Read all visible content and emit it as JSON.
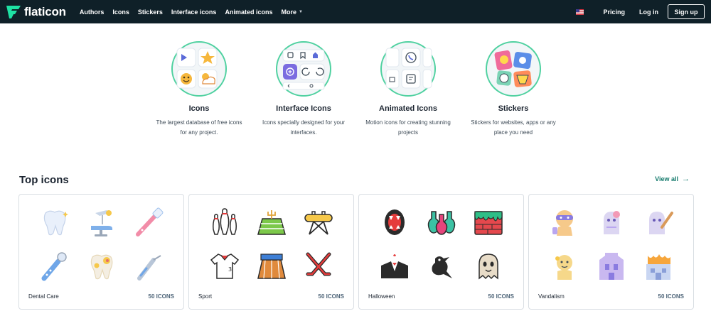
{
  "header": {
    "brand": "flaticon",
    "nav": [
      "Authors",
      "Icons",
      "Stickers",
      "Interface icons",
      "Animated icons"
    ],
    "more_label": "More",
    "flag_icon": "us-flag-icon",
    "pricing": "Pricing",
    "login": "Log in",
    "signup": "Sign up",
    "colors": {
      "bar": "#0f2028",
      "accent": "#4fd1a0"
    }
  },
  "categories": [
    {
      "title": "Icons",
      "desc": "The largest database of free icons for any project."
    },
    {
      "title": "Interface Icons",
      "desc": "Icons specially designed for your interfaces."
    },
    {
      "title": "Animated Icons",
      "desc": "Motion icons for creating stunning projects"
    },
    {
      "title": "Stickers",
      "desc": "Stickers for websites, apps or any place you need"
    }
  ],
  "top_icons": {
    "title": "Top icons",
    "view_all": "View all",
    "packs": [
      {
        "name": "Dental Care",
        "count": "50 ICONS",
        "icons": [
          "tooth-icon",
          "dental-chair-icon",
          "toothbrush-icon",
          "dental-mirror-icon",
          "decayed-tooth-icon",
          "dental-tweezers-icon"
        ]
      },
      {
        "name": "Sport",
        "count": "50 ICONS",
        "icons": [
          "bowling-pins-icon",
          "football-field-icon",
          "pommel-horse-icon",
          "jersey-icon",
          "running-track-icon",
          "hockey-sticks-icon"
        ]
      },
      {
        "name": "Halloween",
        "count": "50 ICONS",
        "icons": [
          "vampire-mouth-icon",
          "potions-icon",
          "bloody-wall-icon",
          "vampire-suit-icon",
          "crow-icon",
          "ghost-icon"
        ]
      },
      {
        "name": "Vandalism",
        "count": "50 ICONS",
        "icons": [
          "masked-vandal-icon",
          "ghost-vandal-icon",
          "vandal-with-bat-icon",
          "vandal-hooded-icon",
          "vandalized-building-icon",
          "burning-house-icon"
        ]
      }
    ]
  }
}
